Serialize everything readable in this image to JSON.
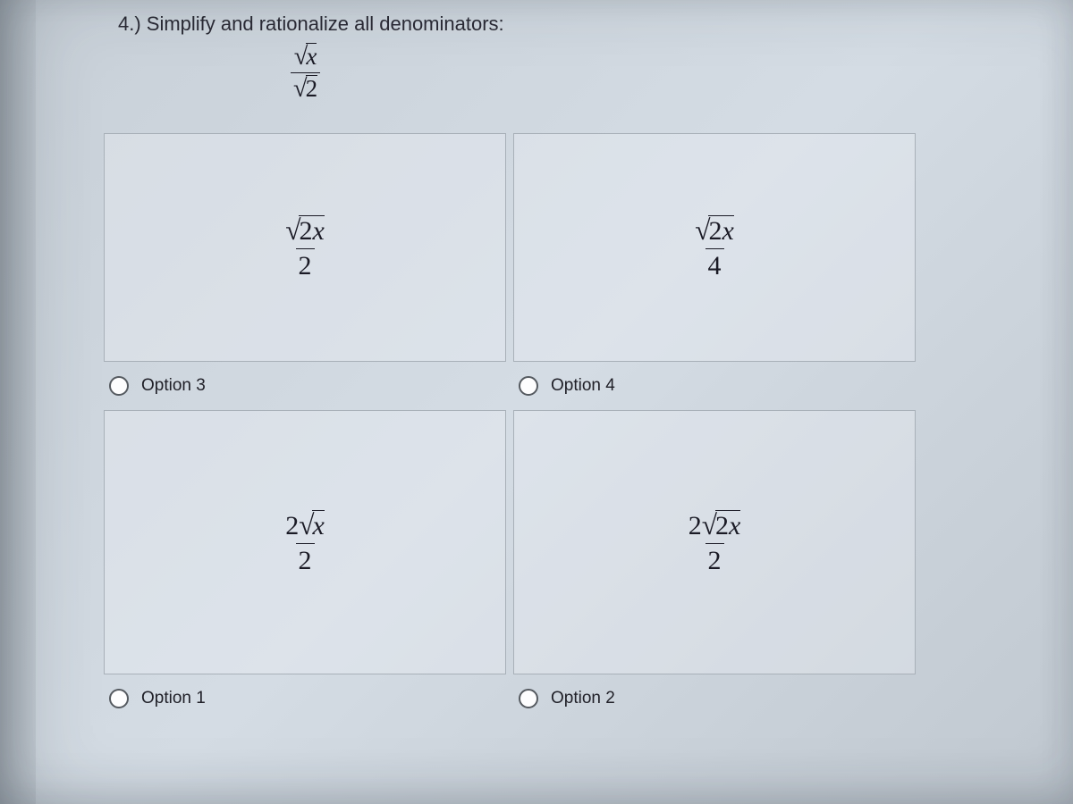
{
  "question": {
    "prompt": "4.) Simplify and rationalize all denominators:",
    "expression": {
      "numerator_rad": "x",
      "denominator_rad": "2"
    }
  },
  "options": [
    {
      "id": "option-3",
      "label": "Option 3",
      "expr": {
        "pre": "",
        "radicand": "2x",
        "denom": "2"
      }
    },
    {
      "id": "option-4",
      "label": "Option 4",
      "expr": {
        "pre": "",
        "radicand": "2x",
        "denom": "4"
      }
    },
    {
      "id": "option-1",
      "label": "Option 1",
      "expr": {
        "pre": "2",
        "radicand": "x",
        "denom": "2"
      }
    },
    {
      "id": "option-2",
      "label": "Option 2",
      "expr": {
        "pre": "2",
        "radicand": "2x",
        "denom": "2"
      }
    }
  ]
}
